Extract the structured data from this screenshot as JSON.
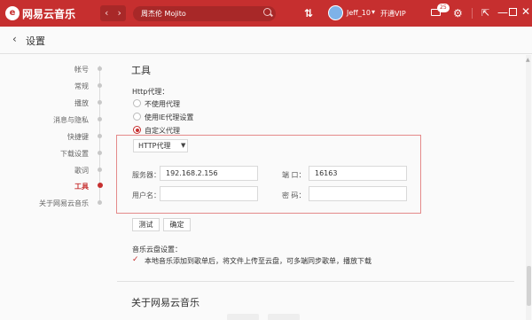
{
  "app": {
    "title": "网易云音乐",
    "logo_glyph": "e"
  },
  "titlebar": {
    "back_glyph": "‹",
    "forward_glyph": "›",
    "search_value": "周杰伦 Mojito",
    "username": "Jeff_10",
    "user_arrow": "▾",
    "vip_label": "开通VIP",
    "mail_count": "25",
    "record_glyph": "⇅",
    "gear_glyph": "⚙",
    "mini_glyph": "⇱",
    "min_glyph": "—",
    "close_glyph": "✕",
    "accent": "#c62f2f"
  },
  "header": {
    "back_glyph": "‹",
    "title": "设置"
  },
  "sidebar": {
    "items": [
      {
        "label": "帐号",
        "active": false
      },
      {
        "label": "常规",
        "active": false
      },
      {
        "label": "播放",
        "active": false
      },
      {
        "label": "消息与隐私",
        "active": false
      },
      {
        "label": "快捷键",
        "active": false
      },
      {
        "label": "下载设置",
        "active": false
      },
      {
        "label": "歌词",
        "active": false
      },
      {
        "label": "工具",
        "active": true
      },
      {
        "label": "关于网易云音乐",
        "active": false
      }
    ]
  },
  "tools": {
    "title": "工具",
    "proxy_label": "Http代理：",
    "radio_options": [
      {
        "label": "不使用代理",
        "checked": false
      },
      {
        "label": "使用IE代理设置",
        "checked": false
      },
      {
        "label": "自定义代理",
        "checked": true
      }
    ],
    "proxy_type": "HTTP代理",
    "select_arrow": "▼",
    "server_label": "服务器：",
    "server_value": "192.168.2.156",
    "port_label": "端    口：",
    "port_value": "16163",
    "user_label": "用户名：",
    "user_value": "",
    "password_label": "密    码：",
    "password_value": "",
    "test_button": "测试",
    "confirm_button": "确定",
    "cloud_label": "音乐云盘设置：",
    "cloud_check_glyph": "✓",
    "cloud_option": "本地音乐添加到歌单后，将文件上传至云盘，可多端同步歌单，播放下载"
  },
  "about": {
    "title": "关于网易云音乐"
  }
}
